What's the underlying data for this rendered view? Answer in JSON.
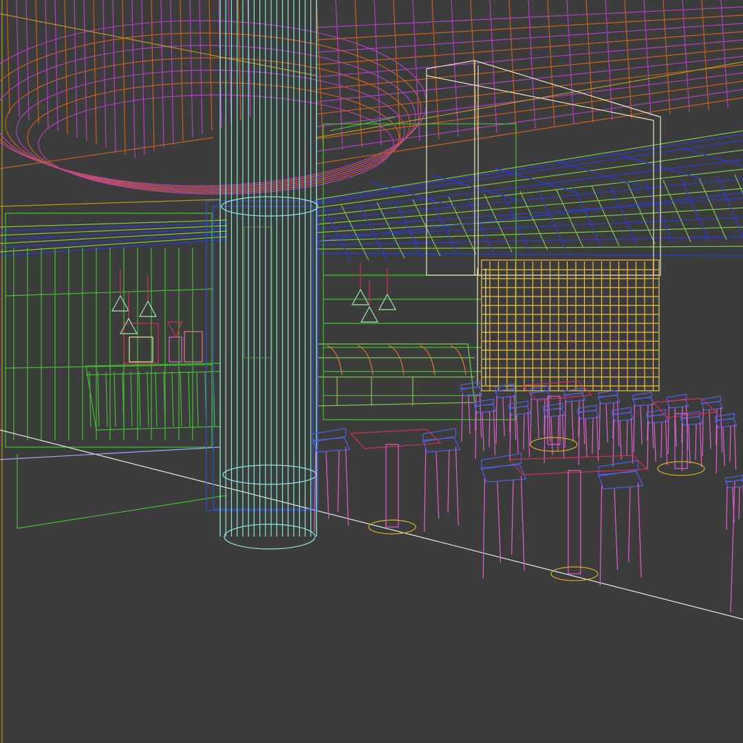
{
  "viewport": {
    "background": "#3c3c3c",
    "render_mode": "wireframe"
  },
  "colors": {
    "ceiling_orange": "#c8601e",
    "ceiling_magenta": "#b040c0",
    "ceiling_yellow": "#b89a20",
    "grid_green": "#7ec850",
    "grid_blue": "#2c3ad8",
    "column_cyan": "#8ee8d8",
    "column_blue": "#3050e0",
    "wall_green": "#40c030",
    "panel_yellow": "#f0c040",
    "white_box": "#e8e8c0",
    "chair_pink": "#e060d0",
    "chair_blue": "#5060e0",
    "table_red": "#d03050",
    "lamp_green": "#a0e8b0",
    "floor_gold": "#d8b020",
    "counter_orange": "#e07840",
    "floor_line": "#e8e8e8"
  },
  "objects": [
    {
      "id": "ceiling-ring",
      "icon": "ellipse-wire"
    },
    {
      "id": "ceiling-grid",
      "icon": "grid-wire"
    },
    {
      "id": "cylinder-column",
      "icon": "cylinder-wire"
    },
    {
      "id": "pendant-lamps",
      "icon": "cone-wire"
    },
    {
      "id": "bar-counter",
      "icon": "box-wire"
    },
    {
      "id": "display-counter",
      "icon": "box-wire"
    },
    {
      "id": "lattice-partition",
      "icon": "grid-wire"
    },
    {
      "id": "dining-tables",
      "icon": "table-wire"
    },
    {
      "id": "dining-chairs",
      "icon": "chair-wire"
    }
  ]
}
